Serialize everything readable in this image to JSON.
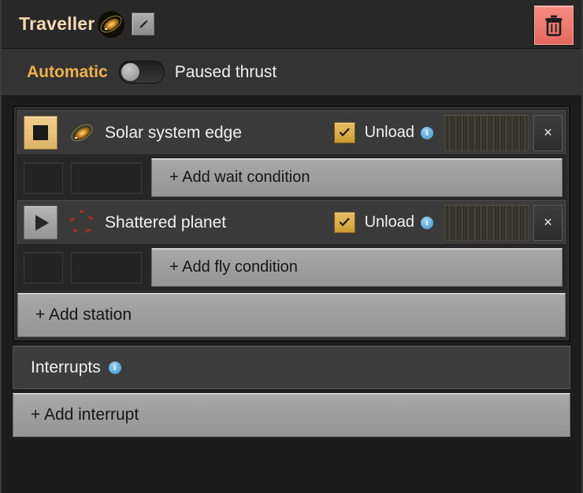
{
  "titlebar": {
    "title": "Traveller",
    "galaxy_icon": "galaxy-icon",
    "edit_icon": "pencil-icon",
    "delete_icon": "trash-icon"
  },
  "automatic_row": {
    "label": "Automatic",
    "toggle_state": "off",
    "state_text": "Paused thrust"
  },
  "stations": [
    {
      "mode_icon": "stop-icon",
      "mode_button_style": "gold",
      "type_icon": "galaxy-icon",
      "name": "Solar system edge",
      "unload_label": "Unload",
      "unload_checked": true,
      "info_icon": "info-icon",
      "drag_handle": "drag-handle-icon",
      "close_icon": "close-icon",
      "condition_label": "+ Add wait condition"
    },
    {
      "mode_icon": "play-icon",
      "mode_button_style": "gray",
      "type_icon": "shattered-planet-icon",
      "name": "Shattered planet",
      "unload_label": "Unload",
      "unload_checked": true,
      "info_icon": "info-icon",
      "drag_handle": "drag-handle-icon",
      "close_icon": "close-icon",
      "condition_label": "+ Add fly condition"
    }
  ],
  "add_station_label": "+ Add station",
  "interrupts": {
    "label": "Interrupts",
    "info_icon": "info-icon"
  },
  "add_interrupt_label": "+ Add interrupt",
  "glyphs": {
    "checkmark": "✔",
    "close": "×",
    "info": "i"
  },
  "colors": {
    "accent_gold": "#edb24a",
    "title_text": "#f5d9b0",
    "delete_red": "#ef7b71",
    "info_blue": "#63aede",
    "panel_dark": "#2a2a2a",
    "button_gray": "#9d9d9d"
  }
}
